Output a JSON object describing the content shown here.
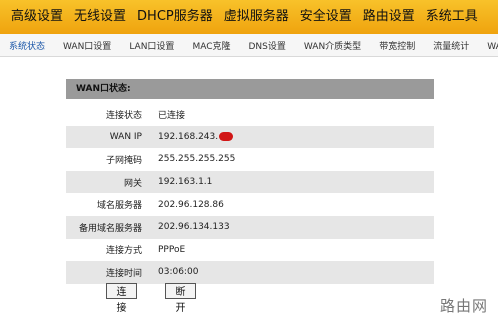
{
  "top_nav": [
    "高级设置",
    "无线设置",
    "DHCP服务器",
    "虚拟服务器",
    "安全设置",
    "路由设置",
    "系统工具"
  ],
  "sub_nav": [
    "系统状态",
    "WAN口设置",
    "LAN口设置",
    "MAC克隆",
    "DNS设置",
    "WAN介质类型",
    "带宽控制",
    "流量统计",
    "WAN速率"
  ],
  "sub_nav_active": "系统状态",
  "panel": {
    "title": "WAN口状态:",
    "rows": [
      {
        "label": "连接状态",
        "value": "已连接"
      },
      {
        "label": "WAN IP",
        "value": "192.168.243."
      },
      {
        "label": "子网掩码",
        "value": "255.255.255.255"
      },
      {
        "label": "网关",
        "value": "192.163.1.1"
      },
      {
        "label": "域名服务器",
        "value": "202.96.128.86"
      },
      {
        "label": "备用域名服务器",
        "value": "202.96.134.133"
      },
      {
        "label": "连接方式",
        "value": "PPPoE"
      },
      {
        "label": "连接时间",
        "value": "03:06:00"
      }
    ]
  },
  "buttons": {
    "connect": "连接",
    "disconnect": "断开"
  },
  "watermark": "路由网",
  "colors": {
    "nav_bar": "#f2b01d",
    "redaction": "#d11616"
  }
}
